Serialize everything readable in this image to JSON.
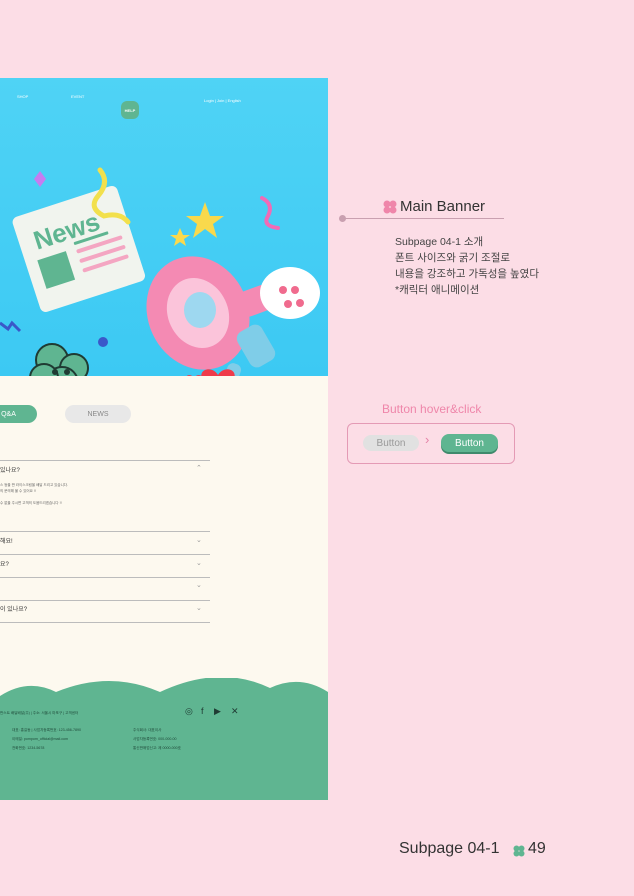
{
  "nav": {
    "shop": "SHOP",
    "event": "EVENT",
    "help": "HELP",
    "login": "Login  |  Join  |  English"
  },
  "banner": {
    "news_text": "News"
  },
  "tabs": {
    "active": "Q&A",
    "inactive": "NEWS"
  },
  "faq": {
    "items": [
      {
        "q": "있나요?",
        "expanded": true
      },
      {
        "q": "해요!"
      },
      {
        "q": "요?"
      },
      {
        "q": ""
      },
      {
        "q": "이 있나요?"
      }
    ],
    "answer_lines": [
      "스 등을 판 라이스크림을 배달 드리고 있습니다.",
      "의 문의해 볼 수 있어요 !!",
      "",
      "수 없을 주시면 고객의 도움드리겠습니다 !!"
    ]
  },
  "footer": {
    "address": "판스트 배달배달(주) | 주소: 서울시 마포구 | 고객센터",
    "line2": "대표: 홍길동 | 사업자등록번호: 123-456-7890",
    "line3": "이메일: pompom_official@mail.com",
    "line4": "전화번호: 1234-5678",
    "right1": "주식회사: 대표이사",
    "right2": "사업자등록번호: 000-000-00",
    "right3": "통신판매업신고: 제 0000-000호",
    "colors": {
      "wave": "#5fb591"
    }
  },
  "annotation": {
    "title": "Main Banner",
    "desc": [
      "Subpage 04-1 소개",
      "폰트 사이즈와 굵기 조절로",
      "내용을 강조하고 가독성을 높였다",
      "*캐릭터 애니메이션"
    ],
    "button_title": "Button hover&click",
    "button_label": "Button",
    "arrow": "›"
  },
  "page": {
    "label": "Subpage 04-1",
    "number": "49"
  },
  "colors": {
    "background": "#fcdde6",
    "accent_green": "#5fb591",
    "accent_pink": "#ef86aa",
    "banner_blue": "#3cc9f3"
  }
}
